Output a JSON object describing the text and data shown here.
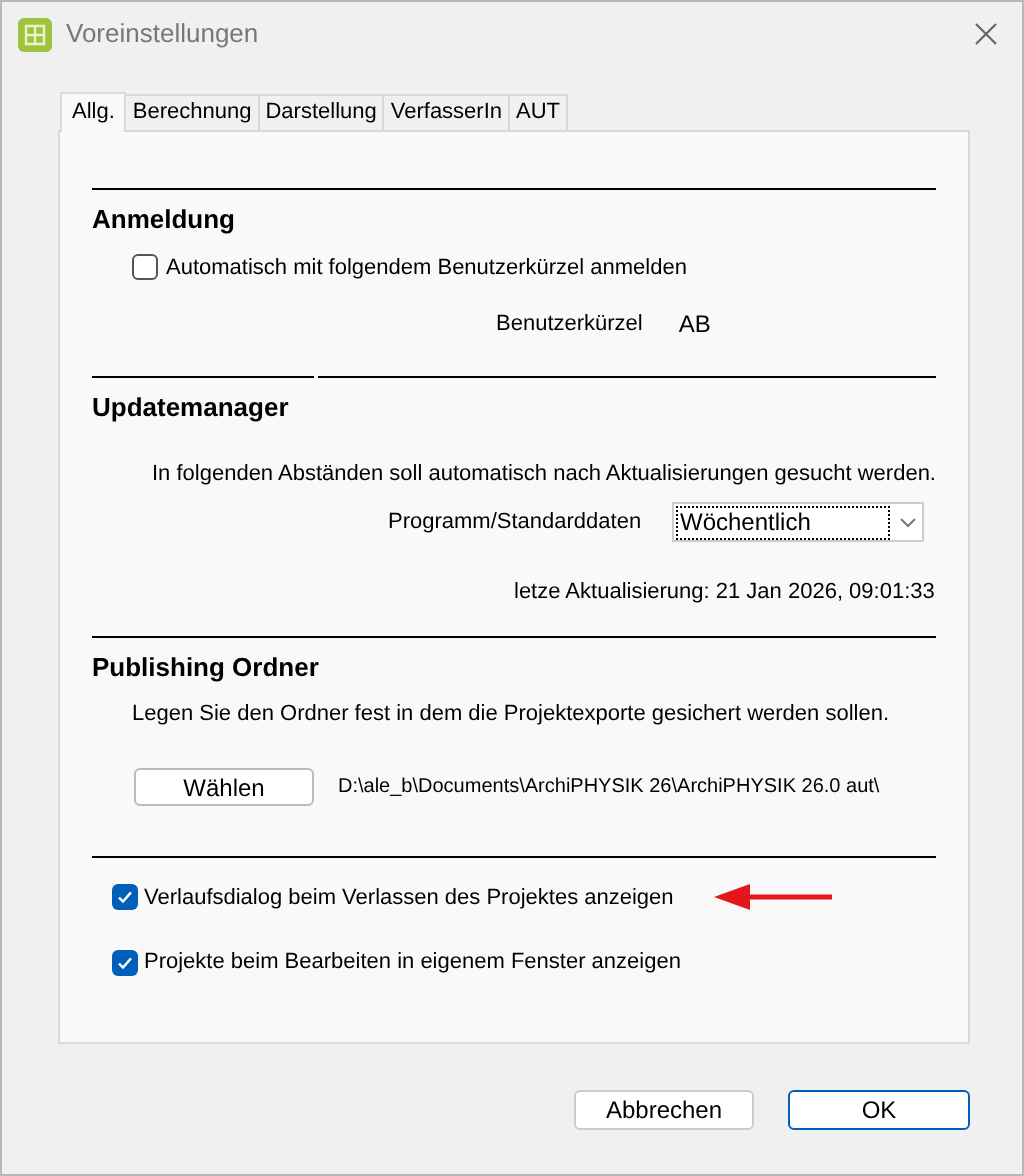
{
  "window": {
    "title": "Voreinstellungen"
  },
  "tabs": [
    {
      "label": "Allg.",
      "selected": true
    },
    {
      "label": "Berechnung",
      "selected": false
    },
    {
      "label": "Darstellung",
      "selected": false
    },
    {
      "label": "VerfasserIn",
      "selected": false
    },
    {
      "label": "AUT",
      "selected": false
    }
  ],
  "login": {
    "heading": "Anmeldung",
    "auto_login": {
      "label": "Automatisch mit folgendem Benutzerkürzel anmelden",
      "checked": false
    },
    "shortcut_label": "Benutzerkürzel",
    "shortcut_value": "AB"
  },
  "updates": {
    "heading": "Updatemanager",
    "description": "In folgenden Abständen soll automatisch nach Aktualisierungen gesucht werden.",
    "interval_label": "Programm/Standarddaten",
    "interval_value": "Wöchentlich",
    "last_update": "letze Aktualisierung: 21 Jan 2026, 09:01:33"
  },
  "publishing": {
    "heading": "Publishing Ordner",
    "description": "Legen Sie den Ordner fest in dem die Projektexporte gesichert werden sollen.",
    "choose_button": "Wählen",
    "path": "D:\\ale_b\\Documents\\ArchiPHYSIK 26\\ArchiPHYSIK 26.0 aut\\"
  },
  "options": [
    {
      "label": "Verlaufsdialog beim Verlassen des Projektes anzeigen",
      "checked": true
    },
    {
      "label": "Projekte beim Bearbeiten in eigenem Fenster anzeigen",
      "checked": true
    }
  ],
  "buttons": [
    "Abbrechen",
    "OK"
  ]
}
